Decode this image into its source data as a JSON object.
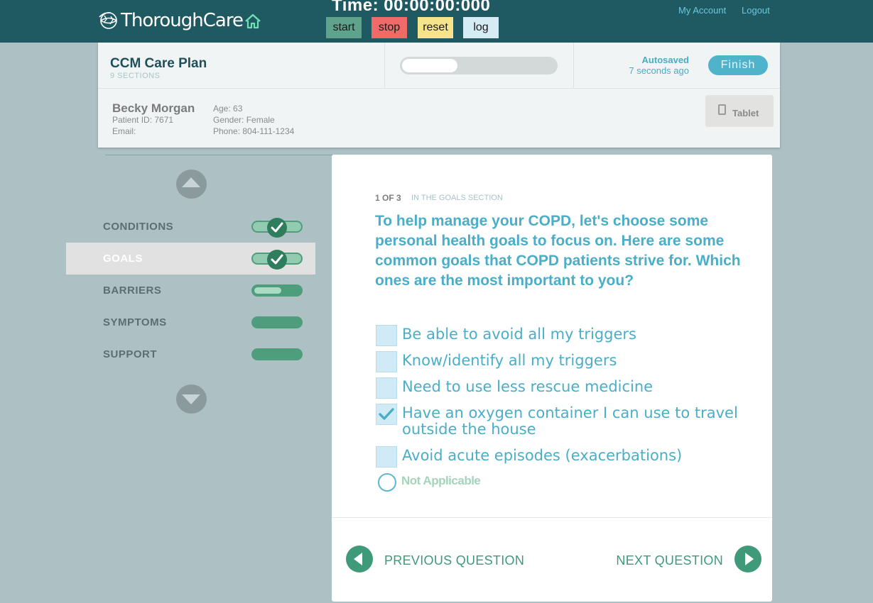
{
  "topbar": {
    "brand": "ThoroughCare",
    "timer": "Time: 00:00:00:000",
    "buttons": {
      "start": "start",
      "stop": "stop",
      "reset": "reset",
      "log": "log"
    },
    "links": {
      "account": "My Account",
      "logout": "Logout"
    }
  },
  "header": {
    "plan_title": "CCM Care Plan",
    "plan_sections": "9 SECTIONS",
    "progress": 0.36,
    "autosaved_label": "Autosaved",
    "autosaved_time": "7 seconds ago",
    "finish_label": "Finish",
    "tablet_label": "Tablet"
  },
  "patient": {
    "name": "Becky Morgan",
    "patient_id": "Patient ID: 7671",
    "email": "Email:",
    "age": "Age: 63",
    "gender": "Gender: Female",
    "phone": "Phone: 804-111-1234"
  },
  "sidebar": {
    "items": [
      {
        "label": "CONDITIONS",
        "status": "complete"
      },
      {
        "label": "GOALS",
        "status": "complete",
        "active": true
      },
      {
        "label": "BARRIERS",
        "status": "partial",
        "progress": 0.6
      },
      {
        "label": "SYMPTOMS",
        "status": "empty"
      },
      {
        "label": "SUPPORT",
        "status": "empty"
      }
    ]
  },
  "question": {
    "count": "1 OF 3",
    "section": "IN THE GOALS SECTION",
    "text": "To help manage your COPD, let's choose some personal health goals to focus on. Here are some common goals that COPD patients strive for. Which ones are the most important to you?",
    "options": [
      {
        "label": "Be able to avoid all my triggers",
        "checked": false
      },
      {
        "label": "Know/identify all my triggers",
        "checked": false
      },
      {
        "label": "Need to use less rescue medicine",
        "checked": false
      },
      {
        "label": "Have an oxygen container I can use to travel outside the house",
        "checked": true
      },
      {
        "label": "Avoid acute episodes (exacerbations)",
        "checked": false
      }
    ],
    "not_applicable": "Not Applicable",
    "prev_label": "PREVIOUS QUESTION",
    "next_label": "NEXT QUESTION"
  }
}
